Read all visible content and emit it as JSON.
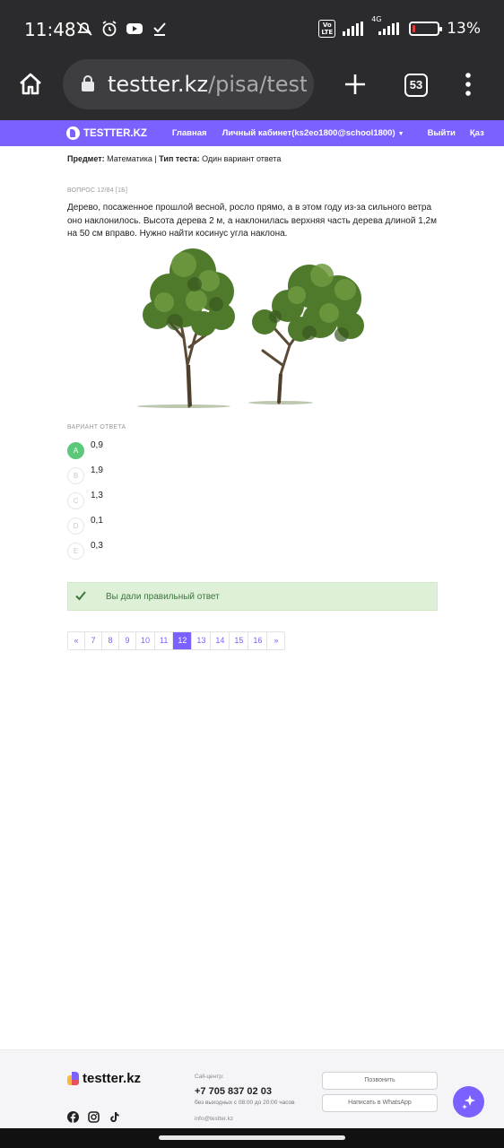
{
  "status_bar": {
    "time": "11:48",
    "network": "4G",
    "battery": "13%",
    "battery_level": 0.13,
    "volte": "Vo LTE",
    "left_icons": [
      "mute-icon",
      "alarm-icon",
      "youtube-icon",
      "download-check-icon"
    ]
  },
  "browser": {
    "url_host": "testter.kz",
    "url_path": "/pisa/test-re",
    "tab_count": "53"
  },
  "site_nav": {
    "logo": "TESTTER.KZ",
    "links": [
      "Главная",
      "Личный кабинет(ks2eo1800@school1800)",
      "Выйти",
      "Қаз"
    ]
  },
  "test": {
    "subject_label": "Предмет:",
    "subject": "Математика",
    "separator": "|",
    "type_label": "Тип теста:",
    "type": "Один вариант ответа",
    "question_number": "ВОПРОС 12/84 [1Б]",
    "question_text": "Дерево, посаженное прошлой весной, росло прямо, а в этом году из-за сильного ветра оно наклонилось. Высота дерева 2 м, а наклонилась верхняя часть дерева длиной 1,2м на 50 см вправо. Нужно найти косинус угла наклона.",
    "answer_label": "ВАРИАНТ ОТВЕТА",
    "options": [
      {
        "letter": "A",
        "value": "0,9",
        "correct": true
      },
      {
        "letter": "B",
        "value": "1,9",
        "correct": false
      },
      {
        "letter": "C",
        "value": "1,3",
        "correct": false
      },
      {
        "letter": "D",
        "value": "0,1",
        "correct": false
      },
      {
        "letter": "E",
        "value": "0,3",
        "correct": false
      }
    ],
    "result_message": "Вы дали правильный ответ"
  },
  "pagination": {
    "prev": "«",
    "pages": [
      "7",
      "8",
      "9",
      "10",
      "11",
      "12",
      "13",
      "14",
      "15",
      "16"
    ],
    "active": "12",
    "next": "»"
  },
  "footer": {
    "logo": "testter.kz",
    "call_center_label": "Call-центр:",
    "phone": "+7 705 837 02 03",
    "hours": "без выходных с 08:00 до 20:00 часов",
    "email": "info@testter.kz",
    "call_button": "Позвонить",
    "whatsapp_button": "Написать в WhatsApp",
    "social_icons": [
      "facebook-icon",
      "instagram-icon",
      "tiktok-icon"
    ]
  },
  "colors": {
    "brand": "#7b61ff",
    "correct": "#5cc97a",
    "success_bg": "#dff0d8",
    "success_text": "#3c763d"
  }
}
